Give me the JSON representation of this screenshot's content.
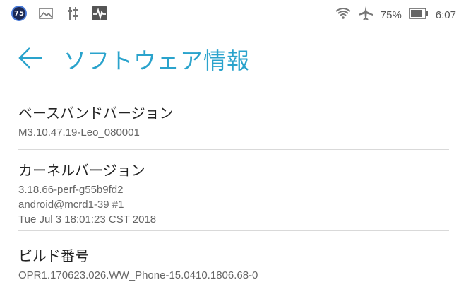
{
  "status_bar": {
    "notification_badge": "75",
    "icons_left": [
      "image-icon",
      "usb-debug-icon",
      "activity-monitor-icon"
    ],
    "icons_right": [
      "wifi-icon",
      "airplane-icon",
      "battery-icon"
    ],
    "battery_percent": "75%",
    "time": "6:07"
  },
  "header": {
    "back_icon": "back-arrow-icon",
    "title": "ソフトウェア情報",
    "accent_color": "#2aa3cc"
  },
  "items": [
    {
      "label": "ベースバンドバージョン",
      "lines": [
        "M3.10.47.19-Leo_080001"
      ]
    },
    {
      "label": "カーネルバージョン",
      "lines": [
        "3.18.66-perf-g55b9fd2",
        "android@mcrd1-39 #1",
        "Tue Jul 3 18:01:23 CST 2018"
      ]
    },
    {
      "label": "ビルド番号",
      "lines": [
        "OPR1.170623.026.WW_Phone-15.0410.1806.68-0"
      ]
    }
  ]
}
